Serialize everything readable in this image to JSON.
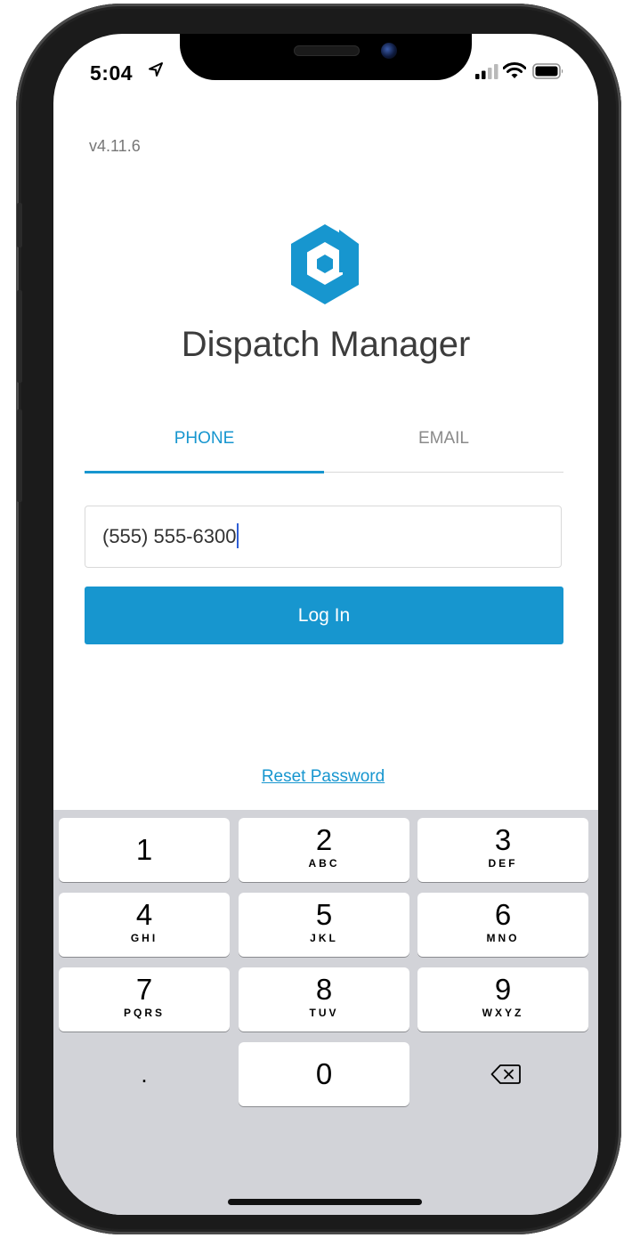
{
  "status_bar": {
    "time": "5:04"
  },
  "app": {
    "version": "v4.11.6",
    "title": "Dispatch Manager",
    "brand_color": "#1796cf"
  },
  "tabs": [
    {
      "label": "PHONE",
      "active": true
    },
    {
      "label": "EMAIL",
      "active": false
    }
  ],
  "phone_input": {
    "value": "(555) 555-6300"
  },
  "login_button": {
    "label": "Log In"
  },
  "reset_link": {
    "label": "Reset Password"
  },
  "keypad": {
    "keys": [
      {
        "digit": "1",
        "letters": ""
      },
      {
        "digit": "2",
        "letters": "ABC"
      },
      {
        "digit": "3",
        "letters": "DEF"
      },
      {
        "digit": "4",
        "letters": "GHI"
      },
      {
        "digit": "5",
        "letters": "JKL"
      },
      {
        "digit": "6",
        "letters": "MNO"
      },
      {
        "digit": "7",
        "letters": "PQRS"
      },
      {
        "digit": "8",
        "letters": "TUV"
      },
      {
        "digit": "9",
        "letters": "WXYZ"
      },
      {
        "digit": "0",
        "letters": ""
      }
    ],
    "decimal": ".",
    "delete_icon": "delete-backspace-icon"
  }
}
